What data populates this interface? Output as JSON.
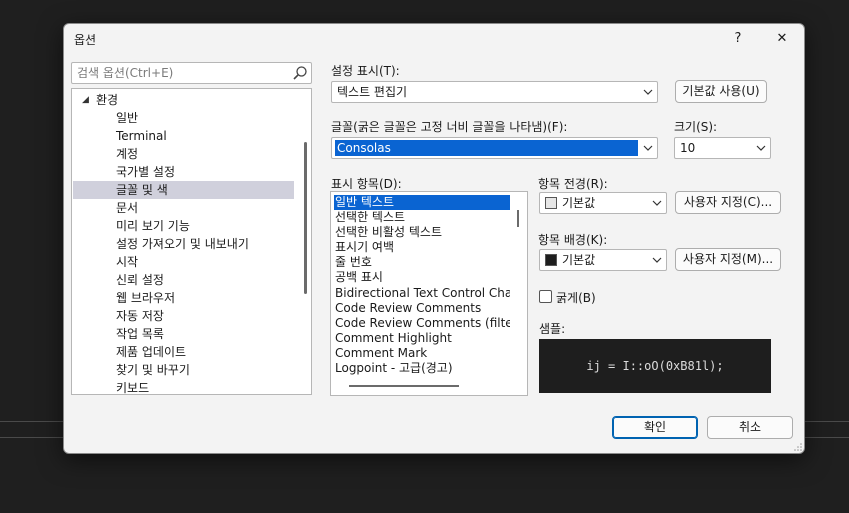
{
  "dialog": {
    "title": "옵션",
    "help_label": "?",
    "close_label": "✕"
  },
  "search": {
    "placeholder": "검색 옵션(Ctrl+E)"
  },
  "tree": {
    "root": "환경",
    "items": [
      "일반",
      "Terminal",
      "계정",
      "국가별 설정",
      "글꼴 및 색",
      "문서",
      "미리 보기 기능",
      "설정 가져오기 및 내보내기",
      "시작",
      "신뢰 설정",
      "웹 브라우저",
      "자동 저장",
      "작업 목록",
      "제품 업데이트",
      "찾기 및 바꾸기",
      "키보드"
    ],
    "selected": "글꼴 및 색"
  },
  "settings": {
    "show_settings_label": "설정 표시(T):",
    "show_settings_value": "텍스트 편집기",
    "use_defaults_label": "기본값 사용(U)",
    "font_label": "글꼴(굵은 글꼴은 고정 너비 글꼴을 나타냄)(F):",
    "font_value": "Consolas",
    "size_label": "크기(S):",
    "size_value": "10",
    "display_items_label": "표시 항목(D):",
    "display_items": [
      "일반 텍스트",
      "선택한 텍스트",
      "선택한 비활성 텍스트",
      "표시기 여백",
      "줄 번호",
      "공백 표시",
      "Bidirectional Text Control Charac",
      "Code Review Comments",
      "Code Review Comments (filtered",
      "Comment Highlight",
      "Comment Mark",
      "Logpoint - 고급(경고)"
    ],
    "selected_item": "일반 텍스트",
    "foreground_label": "항목 전경(R):",
    "foreground_value": "기본값",
    "foreground_custom_label": "사용자 지정(C)...",
    "background_label": "항목 배경(K):",
    "background_value": "기본값",
    "background_custom_label": "사용자 지정(M)...",
    "bold_label": "굵게(B)",
    "sample_label": "샘플:",
    "sample_text": "ij = I::oO(0xB81l);"
  },
  "buttons": {
    "ok": "확인",
    "cancel": "취소"
  },
  "colors": {
    "accent": "#0a64d2",
    "foreground_swatch": "#e6e6e6",
    "background_swatch": "#1e1e1e",
    "sample_bg": "#1e1e1e"
  }
}
